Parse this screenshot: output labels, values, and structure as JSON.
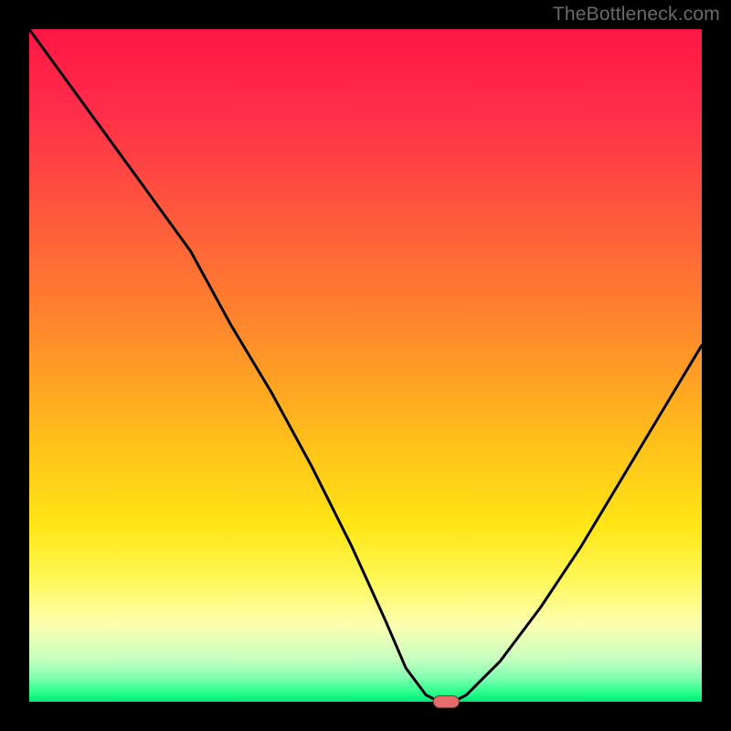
{
  "watermark": "TheBottleneck.com",
  "colors": {
    "frame": "#000000",
    "curve": "#000000",
    "marker_fill": "#e86b6b",
    "marker_stroke": "#7a3a3a"
  },
  "chart_data": {
    "type": "line",
    "title": "",
    "xlabel": "",
    "ylabel": "",
    "xlim": [
      0,
      100
    ],
    "ylim": [
      0,
      100
    ],
    "grid": false,
    "series": [
      {
        "name": "bottleneck-curve",
        "x": [
          0,
          8,
          16,
          24,
          30,
          36,
          42,
          48,
          53,
          56,
          59,
          61,
          63,
          65,
          70,
          76,
          82,
          88,
          94,
          100
        ],
        "y": [
          100,
          89,
          78,
          67,
          56,
          46,
          35,
          23,
          12,
          5,
          1,
          0,
          0,
          1,
          6,
          14,
          23,
          33,
          43,
          53
        ]
      }
    ],
    "annotations": [
      {
        "name": "optimal-marker",
        "x": 62,
        "y": 0,
        "shape": "rounded-rect"
      }
    ],
    "background_gradient": {
      "stops": [
        {
          "offset": 0.0,
          "color": "#ff1744"
        },
        {
          "offset": 0.12,
          "color": "#ff2d4a"
        },
        {
          "offset": 0.28,
          "color": "#ff5a3c"
        },
        {
          "offset": 0.45,
          "color": "#ff8a2b"
        },
        {
          "offset": 0.62,
          "color": "#ffc21a"
        },
        {
          "offset": 0.74,
          "color": "#ffe616"
        },
        {
          "offset": 0.82,
          "color": "#fff85a"
        },
        {
          "offset": 0.885,
          "color": "#fcffb0"
        },
        {
          "offset": 0.935,
          "color": "#c9ffc0"
        },
        {
          "offset": 0.965,
          "color": "#7fffb0"
        },
        {
          "offset": 0.985,
          "color": "#2cff8c"
        },
        {
          "offset": 1.0,
          "color": "#00e879"
        }
      ]
    }
  }
}
